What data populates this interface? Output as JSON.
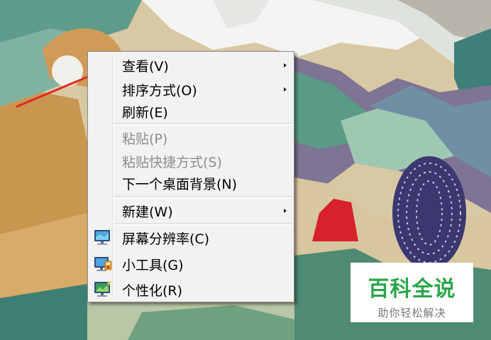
{
  "context_menu": {
    "items": [
      {
        "label": "查看(V)",
        "submenu": true,
        "enabled": true
      },
      {
        "label": "排序方式(O)",
        "submenu": true,
        "enabled": true
      },
      {
        "label": "刷新(E)",
        "submenu": false,
        "enabled": true
      },
      {
        "label": "粘贴(P)",
        "submenu": false,
        "enabled": false
      },
      {
        "label": "粘贴快捷方式(S)",
        "submenu": false,
        "enabled": false
      },
      {
        "label": "下一个桌面背景(N)",
        "submenu": false,
        "enabled": true
      },
      {
        "label": "新建(W)",
        "submenu": true,
        "enabled": true
      },
      {
        "label": "屏幕分辨率(C)",
        "submenu": false,
        "enabled": true,
        "icon": "monitor-icon"
      },
      {
        "label": "小工具(G)",
        "submenu": false,
        "enabled": true,
        "icon": "gadgets-icon"
      },
      {
        "label": "个性化(R)",
        "submenu": false,
        "enabled": true,
        "icon": "personalize-icon"
      }
    ]
  },
  "watermark": {
    "title": "百科全说",
    "subtitle": "助你轻松解决"
  },
  "colors": {
    "menu_background": "#f2f2f2",
    "disabled_text": "#8d8d8d",
    "annotation_arrow": "#e02a22",
    "watermark_green": "#2aa64a"
  }
}
